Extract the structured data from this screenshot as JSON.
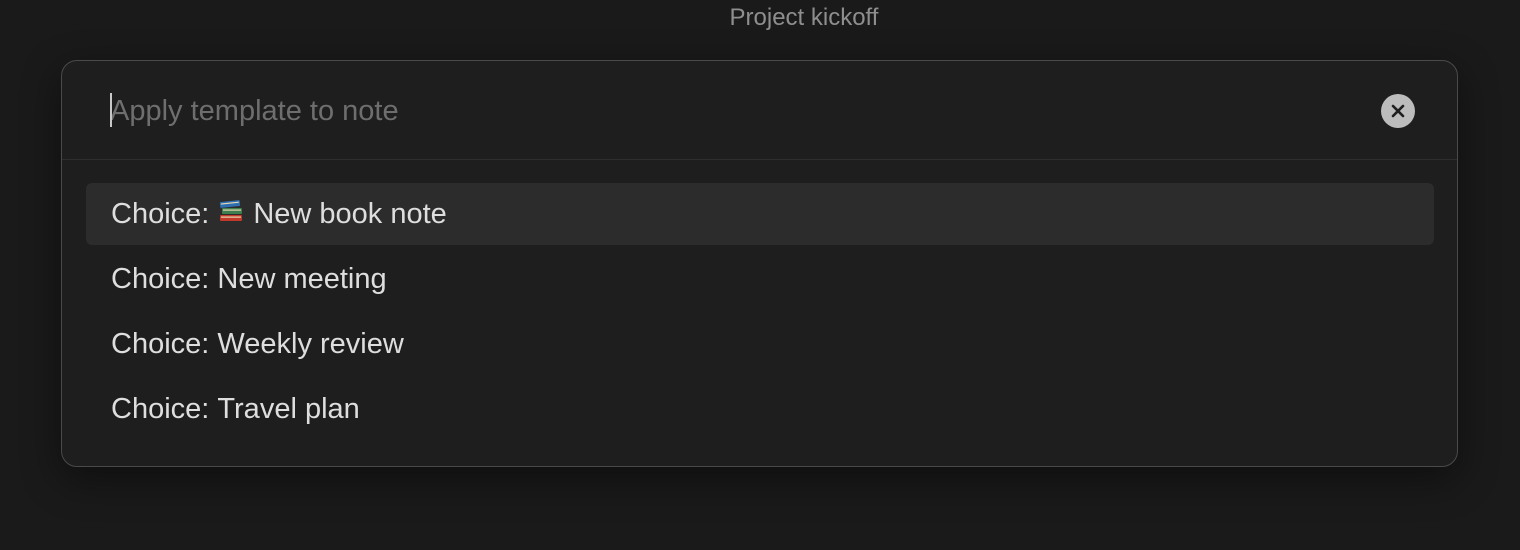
{
  "window": {
    "title": "Project kickoff"
  },
  "prompt": {
    "placeholder": "Apply template to note",
    "value": ""
  },
  "icons": {
    "clear": "close-circle-icon",
    "book": "books-icon"
  },
  "suggestions": [
    {
      "prefix": "Choice:",
      "label": "New book note",
      "icon": "books-icon",
      "selected": true
    },
    {
      "prefix": "Choice:",
      "label": "New meeting",
      "selected": false
    },
    {
      "prefix": "Choice:",
      "label": "Weekly review",
      "selected": false
    },
    {
      "prefix": "Choice:",
      "label": "Travel plan",
      "selected": false
    }
  ],
  "colors": {
    "background": "#1a1a1a",
    "modal": "#1e1e1e",
    "selected_row": "#2c2c2c",
    "text": "#dedede",
    "placeholder": "#6e6e6e"
  }
}
